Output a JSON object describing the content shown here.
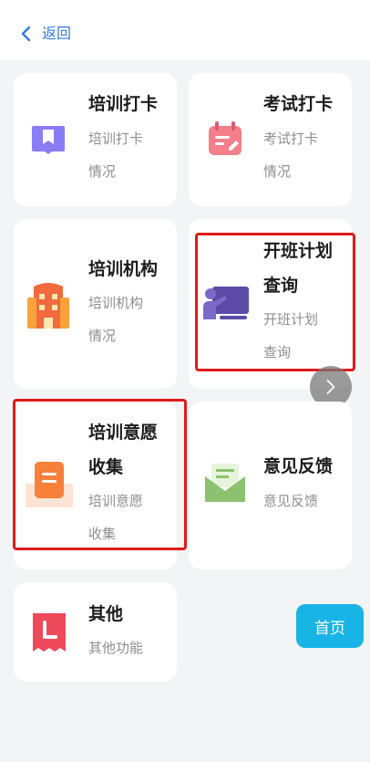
{
  "header": {
    "back_label": "返回"
  },
  "cards": {
    "training_checkin": {
      "title": "培训打卡",
      "desc": "培训打卡情况"
    },
    "exam_checkin": {
      "title": "考试打卡",
      "desc": "考试打卡情况"
    },
    "training_org": {
      "title": "培训机构",
      "desc": "培训机构情况"
    },
    "class_plan": {
      "title": "开班计划查询",
      "desc": "开班计划查询"
    },
    "training_intent": {
      "title": "培训意愿收集",
      "desc": "培训意愿收集"
    },
    "feedback": {
      "title": "意见反馈",
      "desc": "意见反馈"
    },
    "other": {
      "title": "其他",
      "desc": "其他功能"
    }
  },
  "home_button": "首页",
  "colors": {
    "accent": "#2f7de1",
    "highlight_box": "#e11a1a",
    "home_button": "#19b4e6"
  },
  "icons": {
    "back": "chevron-left-icon",
    "training_checkin": "book-icon",
    "exam_checkin": "calendar-edit-icon",
    "training_org": "building-icon",
    "class_plan": "teacher-board-icon",
    "training_intent": "inbox-icon",
    "feedback": "envelope-icon",
    "other": "bookmark-l-icon",
    "next": "chevron-right-icon"
  }
}
